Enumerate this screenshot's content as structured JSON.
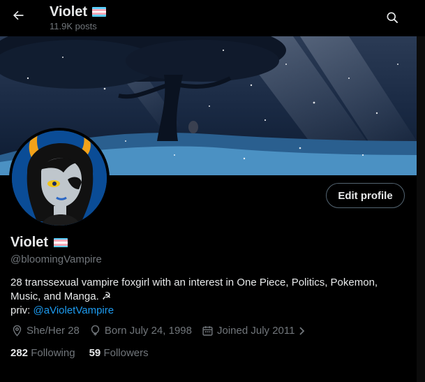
{
  "header": {
    "title": "Violet",
    "posts": "11.9K posts"
  },
  "profile": {
    "name": "Violet",
    "handle": "@bloomingVampire",
    "edit_label": "Edit profile",
    "bio_text": "28 transsexual vampire foxgirl with an interest in One Piece, Politics, Pokemon, Music, and Manga. ☭",
    "priv_label": "priv: ",
    "priv_link": "@aVioletVampire",
    "pronouns": "She/Her 28",
    "born": "Born July 24, 1998",
    "joined": "Joined July 2011",
    "following_count": "282",
    "following_label": "Following",
    "followers_count": "59",
    "followers_label": "Followers"
  },
  "icons": [
    "back-arrow-icon",
    "search-icon",
    "trans-flag-icon",
    "location-icon",
    "balloon-icon",
    "calendar-icon",
    "chevron-right-icon"
  ],
  "colors": {
    "background": "#000000",
    "text": "#e7e9ea",
    "muted": "#71767b",
    "link": "#1d9bf0",
    "flag_blue": "#5bcefa",
    "flag_pink": "#f5a9b8",
    "flag_white": "#ffffff"
  }
}
